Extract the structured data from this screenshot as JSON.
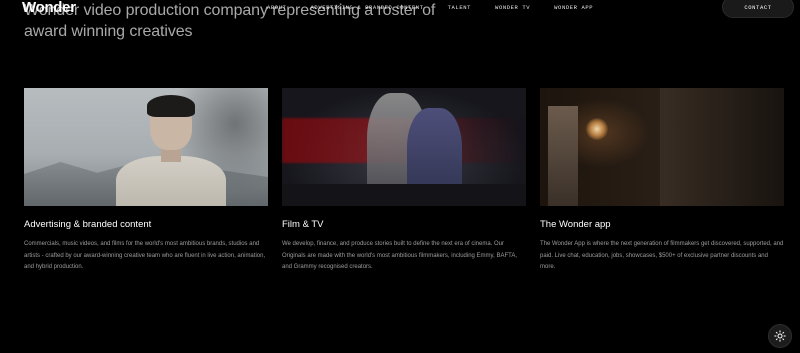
{
  "hero": {
    "title": "Wonder video production company representing a roster of award winning creatives"
  },
  "header": {
    "logo": "Wonder",
    "nav": [
      {
        "label": "ABOUT"
      },
      {
        "label": "ADVERTISING & BRANDED CONTENT"
      },
      {
        "label": "TALENT"
      },
      {
        "label": "WONDER TV"
      },
      {
        "label": "WONDER APP"
      }
    ],
    "contact_label": "CONTACT"
  },
  "cards": [
    {
      "title": "Advertising & branded content",
      "description": "Commercials, music videos, and films for the world's most ambitious brands, studios and artists - crafted by our award-winning creative team who are fluent in live action, animation, and hybrid production."
    },
    {
      "title": "Film & TV",
      "description": "We develop, finance, and produce stories built to define the next era of cinema. Our Originals are made with the world's most ambitious filmmakers, including Emmy, BAFTA, and Grammy recognised creators."
    },
    {
      "title": "The Wonder app",
      "description": "The Wonder App is where the next generation of filmmakers get discovered, supported, and paid. Live chat, education, jobs, showcases, $500+ of exclusive partner discounts and more."
    }
  ],
  "theme_toggle_icon": "sun-icon"
}
